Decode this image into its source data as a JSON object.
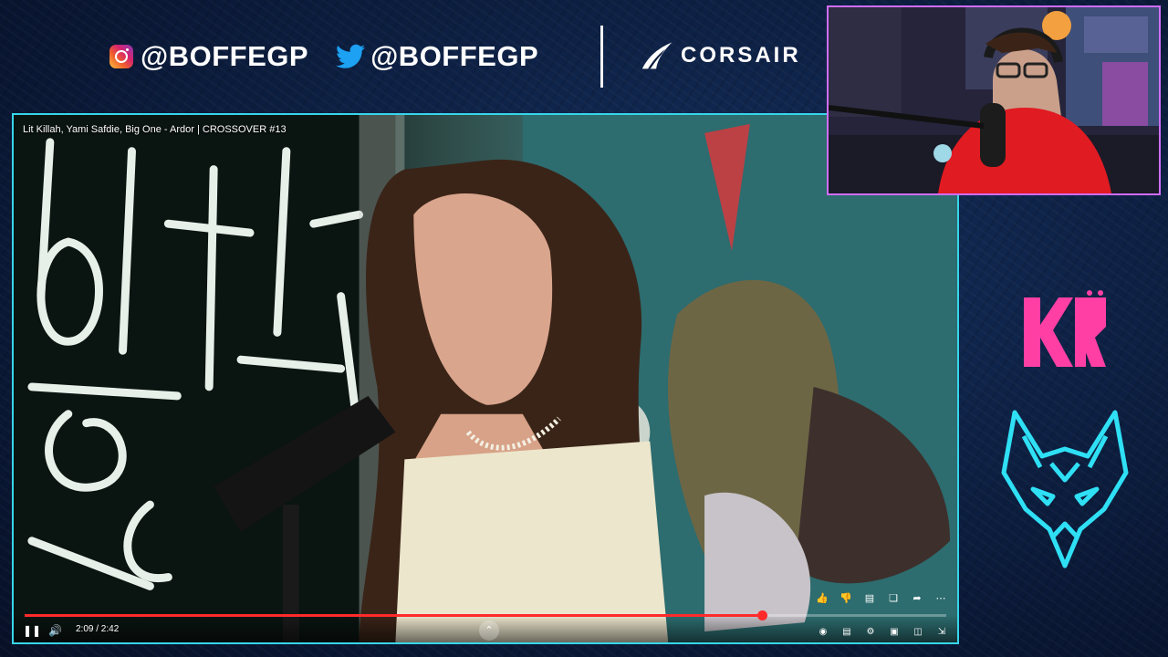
{
  "header": {
    "instagram_handle": "@BOFFEGP",
    "twitter_handle": "@BOFFEGP",
    "sponsor": "CORSAIR"
  },
  "video": {
    "title": "Lit Killah, Yami Safdie, Big One - Ardor | CROSSOVER #13",
    "time": "2:09 / 2:42",
    "progress": 0.8,
    "accent_color": "#ff2a2a"
  },
  "controls": {
    "left": [
      "pause-icon",
      "volume-icon"
    ],
    "actions": [
      "like-icon",
      "dislike-icon",
      "comment-icon",
      "save-icon",
      "share-icon",
      "more-icon"
    ],
    "right": [
      "autoplay-icon",
      "subtitles-icon",
      "settings-icon",
      "miniplayer-icon",
      "cast-icon",
      "collapse-icon"
    ]
  },
  "overlay": {
    "border_color": "#37d6ea",
    "cam_border_color": "#d06dff",
    "team_logo_color": "#ff3fa4",
    "fox_logo_color": "#2fe0f5"
  }
}
